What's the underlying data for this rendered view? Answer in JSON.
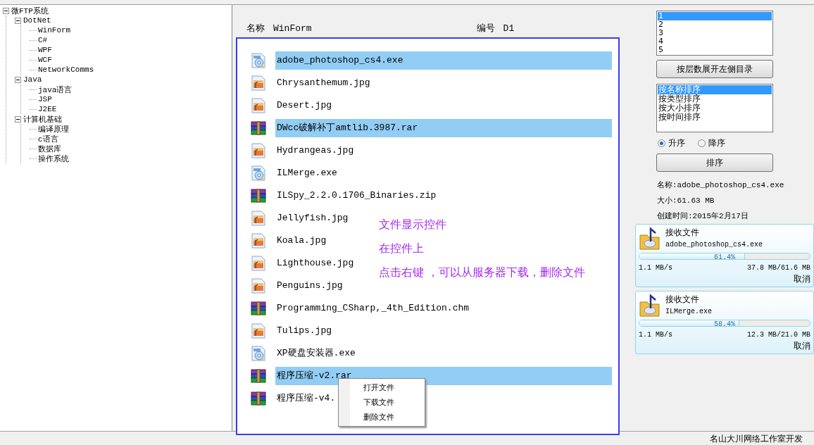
{
  "tree": [
    {
      "label": "微FTP系统",
      "expanded": true,
      "children": [
        {
          "label": "DotNet",
          "expanded": true,
          "children": [
            {
              "label": "WinForm"
            },
            {
              "label": "C#"
            },
            {
              "label": "WPF"
            },
            {
              "label": "WCF"
            },
            {
              "label": "NetworkComms"
            }
          ]
        },
        {
          "label": "Java",
          "expanded": true,
          "children": [
            {
              "label": "java语言"
            },
            {
              "label": "JSP"
            },
            {
              "label": "J2EE"
            }
          ]
        },
        {
          "label": "计算机基础",
          "expanded": true,
          "children": [
            {
              "label": "编译原理"
            },
            {
              "label": "c语言"
            },
            {
              "label": "数据库"
            },
            {
              "label": "操作系统"
            }
          ]
        }
      ]
    }
  ],
  "header": {
    "name_label": "名称",
    "name_value": "WinForm",
    "code_label": "编号",
    "code_value": "D1"
  },
  "files": [
    {
      "name": "adobe_photoshop_cs4.exe",
      "kind": "exe",
      "selected": true
    },
    {
      "name": "Chrysanthemum.jpg",
      "kind": "image",
      "selected": false
    },
    {
      "name": "Desert.jpg",
      "kind": "image",
      "selected": false
    },
    {
      "name": "DWcc破解补丁amtlib.3987.rar",
      "kind": "archive",
      "selected": true
    },
    {
      "name": "Hydrangeas.jpg",
      "kind": "image",
      "selected": false
    },
    {
      "name": "ILMerge.exe",
      "kind": "exe",
      "selected": false
    },
    {
      "name": "ILSpy_2.2.0.1706_Binaries.zip",
      "kind": "archive",
      "selected": false
    },
    {
      "name": "Jellyfish.jpg",
      "kind": "image",
      "selected": false
    },
    {
      "name": "Koala.jpg",
      "kind": "image",
      "selected": false
    },
    {
      "name": "Lighthouse.jpg",
      "kind": "image",
      "selected": false
    },
    {
      "name": "Penguins.jpg",
      "kind": "image",
      "selected": false
    },
    {
      "name": "Programming_CSharp,_4th_Edition.chm",
      "kind": "archive",
      "selected": false
    },
    {
      "name": "Tulips.jpg",
      "kind": "image",
      "selected": false
    },
    {
      "name": "XP硬盘安装器.exe",
      "kind": "exe",
      "selected": false
    },
    {
      "name": "程序压缩-v2.rar",
      "kind": "archive",
      "selected": true
    },
    {
      "name": "程序压缩-v4.",
      "kind": "archive",
      "selected": false
    }
  ],
  "annotation": [
    "文件显示控件",
    "在控件上",
    "点击右键 ，可以从服务器下载，删除文件"
  ],
  "context_menu": [
    "打开文件",
    "下载文件",
    "删除文件"
  ],
  "level_list": [
    {
      "label": "1",
      "selected": true
    },
    {
      "label": "2",
      "selected": false
    },
    {
      "label": "3",
      "selected": false
    },
    {
      "label": "4",
      "selected": false
    },
    {
      "label": "5",
      "selected": false
    }
  ],
  "expand_button": "按层数展开左侧目录",
  "sort_list": [
    {
      "label": "按名称排序",
      "selected": true
    },
    {
      "label": "按类型排序",
      "selected": false
    },
    {
      "label": "按大小排序",
      "selected": false
    },
    {
      "label": "按时间排序",
      "selected": false
    }
  ],
  "order_radios": [
    {
      "label": "升序",
      "selected": true
    },
    {
      "label": "降序",
      "selected": false
    }
  ],
  "sort_button": "排序",
  "info": [
    "名称:adobe_photoshop_cs4.exe",
    "大小:61.63 MB",
    "创建时间:2015年2月17日"
  ],
  "transfers": [
    {
      "title": "接收文件",
      "file": "adobe_photoshop_cs4.exe",
      "level": 0.614,
      "percent": "61.4%",
      "speed": "1.1 MB/s",
      "size": "37.8 MB/61.6 MB",
      "cancel": "取消"
    },
    {
      "title": "接收文件",
      "file": "ILMerge.exe",
      "level": 0.584,
      "percent": "58.4%",
      "speed": "1.1 MB/s",
      "size": "12.3 MB/21.0 MB",
      "cancel": "取消"
    }
  ],
  "status_bar": "名山大川网络工作室开发"
}
